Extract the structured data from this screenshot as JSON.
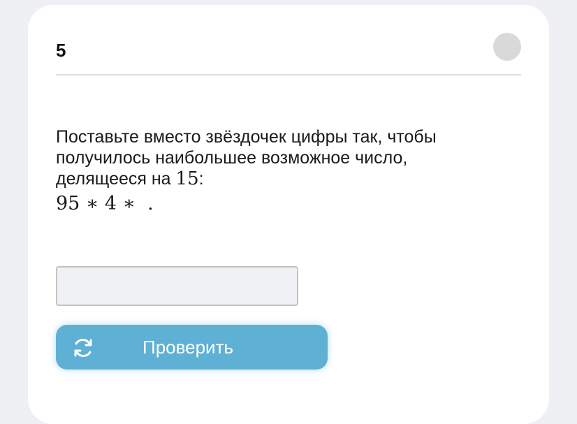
{
  "task": {
    "number": "5"
  },
  "question": {
    "line1": "Поставьте вместо звёздочек цифры так, чтобы",
    "line2": "получилось наибольшее возможное число,",
    "line3_text": "делящееся на ",
    "line3_number": "15",
    "line3_colon": ":",
    "expression": "95 ∗ 4 ∗  ."
  },
  "answer": {
    "value": "",
    "placeholder": ""
  },
  "check_button": {
    "label": "Проверить",
    "icon": "refresh-icon"
  },
  "colors": {
    "background": "#eff0f4",
    "card": "#ffffff",
    "button": "#5eb0d5",
    "status_dot": "#d9d9d9",
    "input_bg": "#f0f1f5"
  }
}
